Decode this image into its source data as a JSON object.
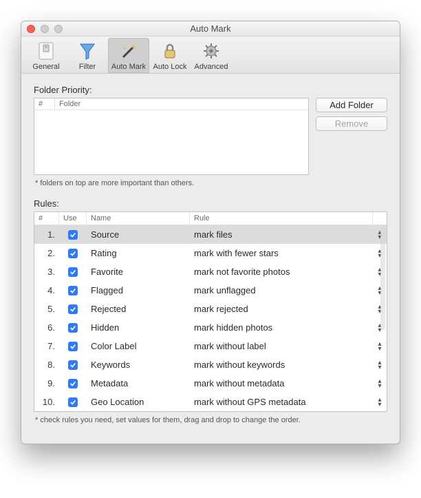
{
  "window": {
    "title": "Auto Mark"
  },
  "toolbar": {
    "items": [
      {
        "label": "General"
      },
      {
        "label": "Filter"
      },
      {
        "label": "Auto Mark"
      },
      {
        "label": "Auto Lock"
      },
      {
        "label": "Advanced"
      }
    ],
    "selected_index": 2
  },
  "folder_section": {
    "title": "Folder Priority:",
    "columns": {
      "num": "#",
      "folder": "Folder"
    },
    "buttons": {
      "add": "Add Folder",
      "remove": "Remove"
    },
    "hint": "* folders on top are more important than others."
  },
  "rules_section": {
    "title": "Rules:",
    "columns": {
      "num": "#",
      "use": "Use",
      "name": "Name",
      "rule": "Rule"
    },
    "rows": [
      {
        "num": "1.",
        "use": true,
        "name": "Source",
        "rule": "mark files",
        "selected": true
      },
      {
        "num": "2.",
        "use": true,
        "name": "Rating",
        "rule": "mark with fewer stars",
        "selected": false
      },
      {
        "num": "3.",
        "use": true,
        "name": "Favorite",
        "rule": "mark not favorite photos",
        "selected": false
      },
      {
        "num": "4.",
        "use": true,
        "name": "Flagged",
        "rule": "mark unflagged",
        "selected": false
      },
      {
        "num": "5.",
        "use": true,
        "name": "Rejected",
        "rule": "mark rejected",
        "selected": false
      },
      {
        "num": "6.",
        "use": true,
        "name": "Hidden",
        "rule": "mark hidden photos",
        "selected": false
      },
      {
        "num": "7.",
        "use": true,
        "name": "Color Label",
        "rule": "mark without label",
        "selected": false
      },
      {
        "num": "8.",
        "use": true,
        "name": "Keywords",
        "rule": "mark without keywords",
        "selected": false
      },
      {
        "num": "9.",
        "use": true,
        "name": "Metadata",
        "rule": "mark without metadata",
        "selected": false
      },
      {
        "num": "10.",
        "use": true,
        "name": "Geo Location",
        "rule": "mark without GPS metadata",
        "selected": false
      }
    ],
    "hint": "* check rules you need, set values for them, drag and drop to change the order."
  }
}
